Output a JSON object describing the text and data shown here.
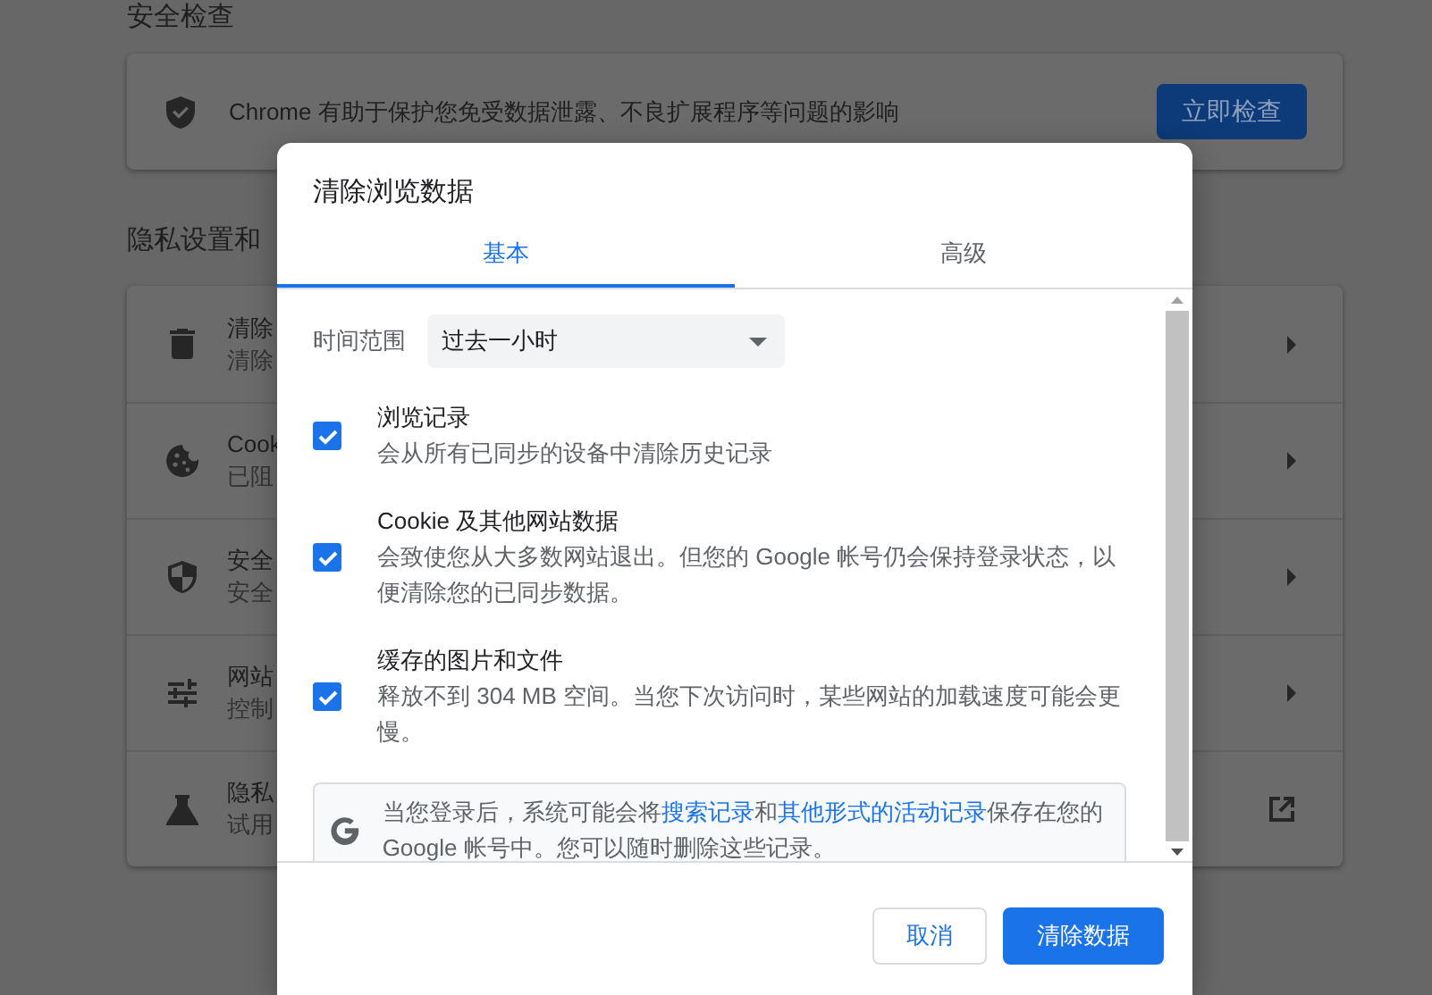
{
  "safety_check": {
    "heading": "安全检查",
    "text": "Chrome 有助于保护您免受数据泄露、不良扩展程序等问题的影响",
    "button": "立即检查"
  },
  "privacy": {
    "heading": "隐私设置和",
    "rows": [
      {
        "kind": "submenu",
        "title": "清除",
        "subtitle": "清除"
      },
      {
        "kind": "submenu",
        "title": "Cook",
        "subtitle": "已阻"
      },
      {
        "kind": "submenu",
        "title": "安全",
        "subtitle": "安全"
      },
      {
        "kind": "submenu",
        "title": "网站",
        "subtitle": "控制"
      },
      {
        "kind": "external",
        "title": "隐私",
        "subtitle": "试用"
      }
    ]
  },
  "dialog": {
    "title": "清除浏览数据",
    "tabs": [
      {
        "label": "基本",
        "selected": true
      },
      {
        "label": "高级",
        "selected": false
      }
    ],
    "time_range": {
      "label": "时间范围",
      "value": "过去一小时"
    },
    "options": [
      {
        "title": "浏览记录",
        "description": "会从所有已同步的设备中清除历史记录",
        "checked": true
      },
      {
        "title": "Cookie 及其他网站数据",
        "description": "会致使您从大多数网站退出。但您的 Google 帐号仍会保持登录状态，以便清除您的已同步数据。",
        "checked": true
      },
      {
        "title": "缓存的图片和文件",
        "description": "释放不到 304 MB 空间。当您下次访问时，某些网站的加载速度可能会更慢。",
        "checked": true
      }
    ],
    "info": {
      "segments": [
        {
          "kind": "text",
          "text": "当您登录后，系统可能会将"
        },
        {
          "kind": "link",
          "text": "搜索记录"
        },
        {
          "kind": "text",
          "text": "和"
        },
        {
          "kind": "link",
          "text": "其他形式的活动记录"
        },
        {
          "kind": "text",
          "text": "保存在您的 Google 帐号中。您可以随时删除这些记录。"
        }
      ]
    },
    "buttons": [
      {
        "label": "取消",
        "kind": "secondary"
      },
      {
        "label": "清除数据",
        "kind": "primary"
      }
    ]
  }
}
